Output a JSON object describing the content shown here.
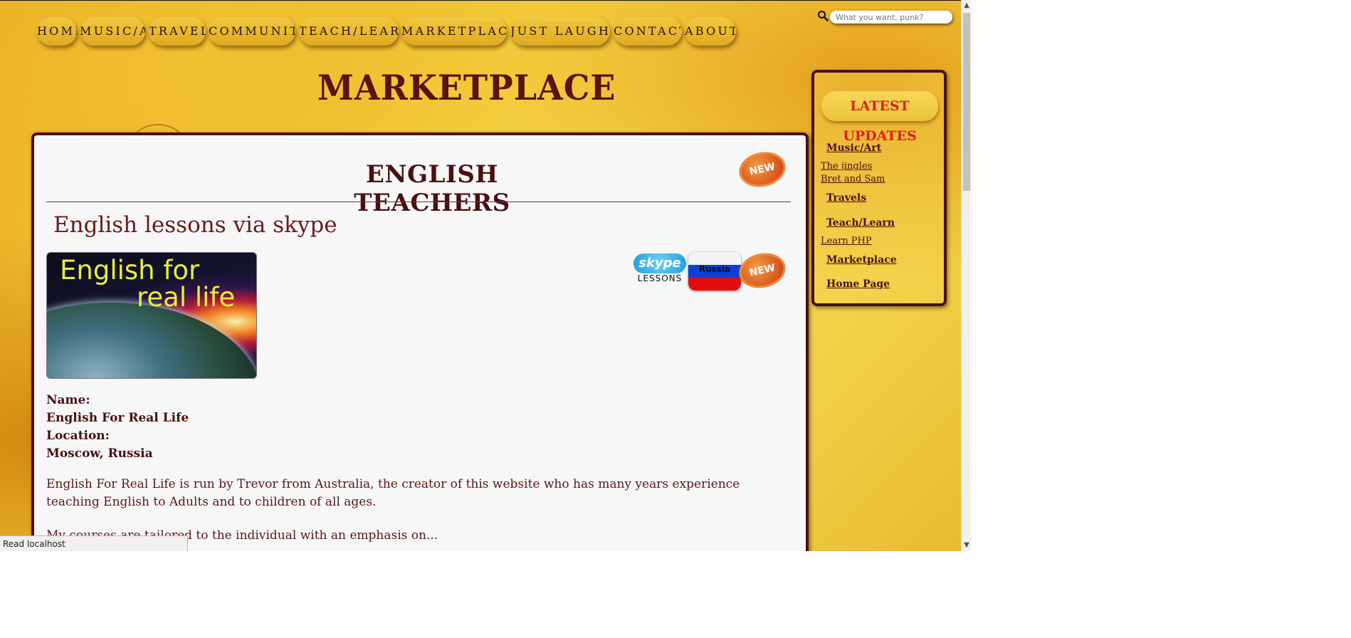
{
  "nav": {
    "items": [
      "HOME",
      "MUSIC/ART",
      "TRAVELS",
      "COMMUNITY",
      "TEACH/LEARN",
      "MARKETPLACE",
      "JUST LAUGHS",
      "CONTACT",
      "ABOUT"
    ]
  },
  "search": {
    "placeholder": "What you want, punk?"
  },
  "page": {
    "title": "MARKETPLACE"
  },
  "main": {
    "section_title": "ENGLISH TEACHERS",
    "new_badge": "NEW",
    "article_title": "English lessons via skype",
    "hero_text_line1": "English for",
    "hero_text_line2": "real life",
    "skype_brand": "skype",
    "skype_caption": "LESSONS",
    "flag_label": "Russia",
    "name_label": "Name:",
    "name_value": "English For Real Life",
    "location_label": "Location:",
    "location_value": "Moscow, Russia",
    "paragraph1": "English For Real Life is run by Trevor from Australia, the creator of this website who has many years experience teaching English to Adults and to children of all ages.",
    "paragraph2": "My courses are tailored to the individual with an emphasis on..."
  },
  "sidebar": {
    "heading": "LATEST UPDATES",
    "music_art": "Music/Art",
    "jingles": "The jingles",
    "bret_sam": "Bret and Sam",
    "travels": "Travels",
    "teach_learn": "Teach/Learn",
    "learn_php": "Learn PHP",
    "marketplace": "Marketplace",
    "home_page": "Home Page"
  },
  "status": {
    "text": "Read localhost"
  },
  "colors": {
    "accent_dark": "#4a1010",
    "heading_red": "#e0201a",
    "nav_gold": "#f1c943",
    "new_badge_orange": "#d8561a",
    "flag_white": "#ffffff",
    "flag_blue": "#0b3fd6",
    "flag_red": "#e40d0d"
  }
}
